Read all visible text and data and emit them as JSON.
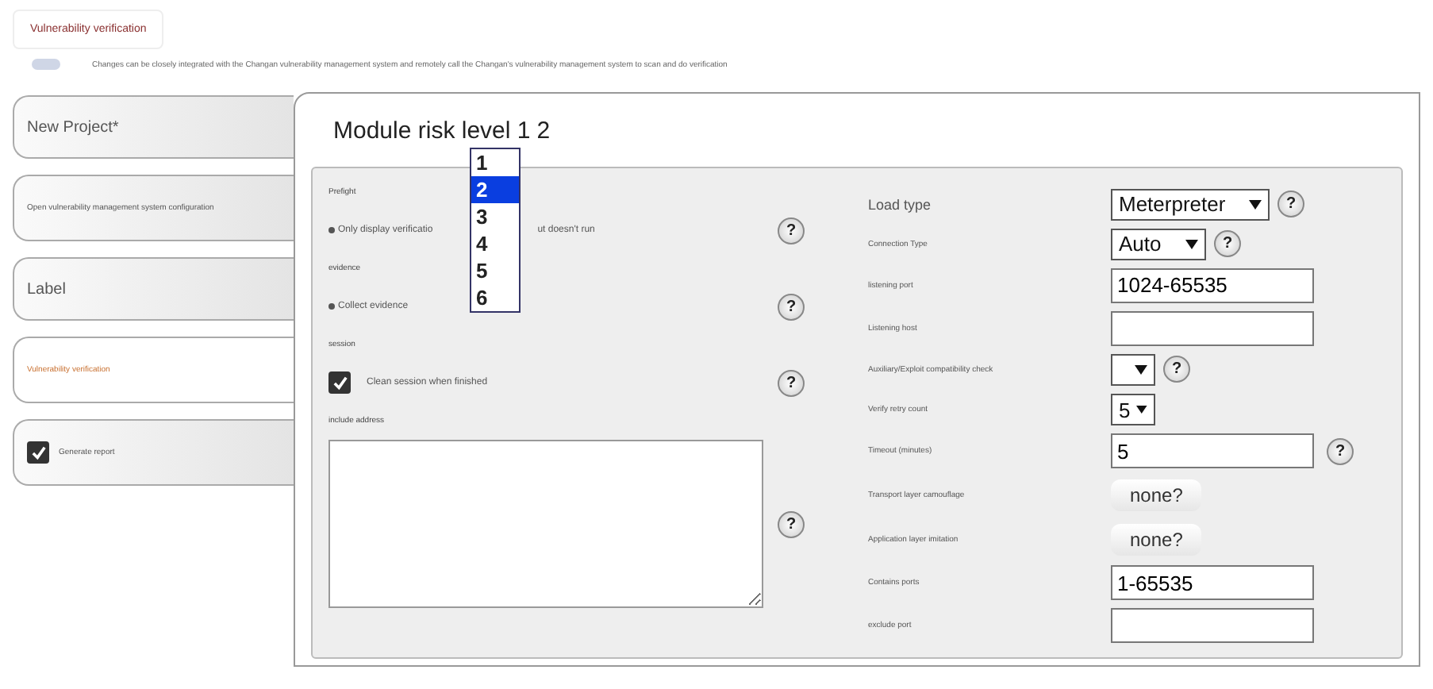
{
  "header": {
    "title": "Vulnerability verification",
    "description": "Changes can be closely integrated with the Changan vulnerability management system and remotely call the Changan's vulnerability management system to scan and do verification"
  },
  "sidebar": {
    "items": [
      {
        "label": "New Project*",
        "kind": "heading",
        "selected": false
      },
      {
        "label": "Open vulnerability management system configuration",
        "kind": "note",
        "selected": false
      },
      {
        "label": "Label",
        "kind": "heading",
        "selected": false
      },
      {
        "label": "Vulnerability verification",
        "kind": "note",
        "selected": true
      },
      {
        "label": "Generate report",
        "kind": "checkbox",
        "selected": false,
        "checked": true
      }
    ]
  },
  "module": {
    "title_before": "Module risk level 1",
    "title_after": "2",
    "risk_options": [
      {
        "label": "1",
        "selected": false
      },
      {
        "label": "2",
        "selected": true
      },
      {
        "label": "3",
        "selected": false
      },
      {
        "label": "4",
        "selected": false
      },
      {
        "label": "5",
        "selected": false
      },
      {
        "label": "6",
        "selected": false
      }
    ]
  },
  "left": [
    {
      "kind": "label",
      "text": "Prefight"
    },
    {
      "kind": "radio",
      "text": "Only display verificatio",
      "text_after": "ut doesn't run",
      "help": "?"
    },
    {
      "kind": "label",
      "text": "evidence"
    },
    {
      "kind": "radio",
      "text": "Collect evidence",
      "help": "?"
    },
    {
      "kind": "label",
      "text": "session"
    },
    {
      "kind": "checkbox",
      "text": "Clean session when finished",
      "checked": true,
      "help": "?"
    },
    {
      "kind": "label",
      "text": "include address"
    },
    {
      "kind": "textarea",
      "help": "?"
    }
  ],
  "right": [
    {
      "label": "Load type",
      "kind": "select",
      "value": "Meterpreter",
      "help": "?"
    },
    {
      "label": "Connection Type",
      "kind": "select",
      "value": "Auto",
      "help": "?"
    },
    {
      "label": "listening port",
      "kind": "input",
      "value": "1024-65535"
    },
    {
      "label": "Listening host",
      "kind": "input"
    },
    {
      "label": "Auxiliary/Exploit compatibility check",
      "kind": "select",
      "help": "?"
    },
    {
      "label": "Verify retry count",
      "kind": "select",
      "value": "5"
    },
    {
      "label": "Timeout (minutes)",
      "kind": "input",
      "value": "5",
      "help": "?"
    },
    {
      "label": "Transport layer camouflage",
      "kind": "button",
      "value": "none?"
    },
    {
      "label": "Application layer imitation",
      "kind": "button",
      "value": "none?"
    },
    {
      "label": "Contains ports",
      "kind": "input",
      "value": "1-65535"
    },
    {
      "label": "exclude port",
      "kind": "input"
    }
  ]
}
